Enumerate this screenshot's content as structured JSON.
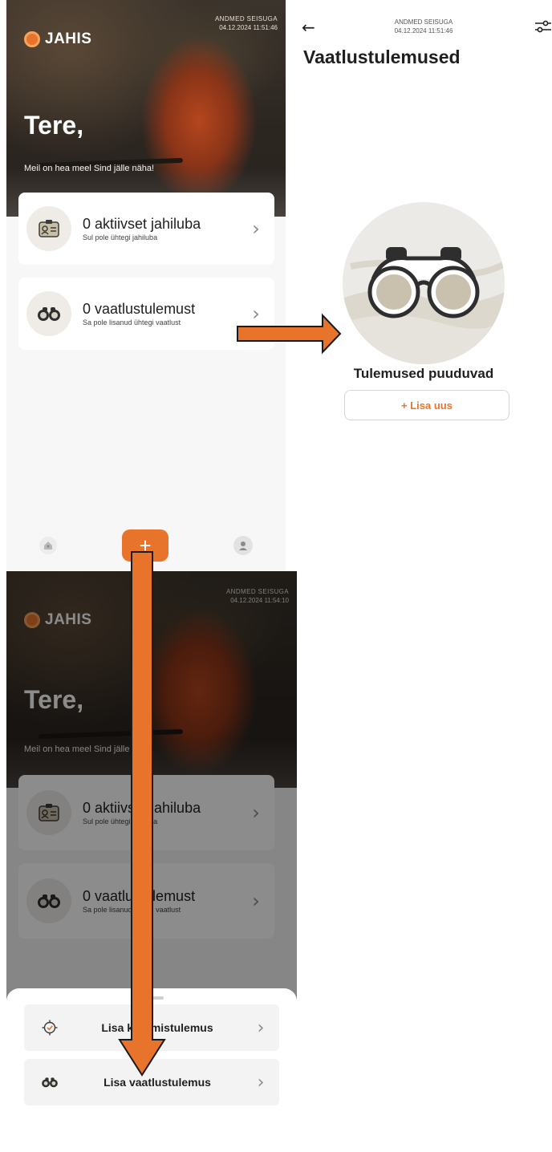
{
  "app": {
    "logo_text": "JAHIS"
  },
  "home": {
    "stamp_label": "ANDMED SEISUGA",
    "stamp_time": "04.12.2024 11:51:46",
    "greeting": "Tere,",
    "greeting_sub": "Meil on hea meel Sind jälle näha!",
    "cards": [
      {
        "title": "0 aktiivset jahiluba",
        "subtitle": "Sul pole ühtegi jahiluba",
        "icon": "id-card-icon"
      },
      {
        "title": "0 vaatlustulemust",
        "subtitle": "Sa pole lisanud ühtegi vaatlust",
        "icon": "binoculars-icon"
      }
    ],
    "nav": {
      "home_icon": "home-icon",
      "add_label": "+",
      "profile_icon": "profile-icon"
    }
  },
  "results": {
    "stamp_label": "ANDMED SEISUGA",
    "stamp_time": "04.12.2024 11:51:46",
    "title": "Vaatlustulemused",
    "empty_title": "Tulemused puuduvad",
    "add_button": "+ Lisa uus"
  },
  "sheet_screen": {
    "stamp_label": "ANDMED SEISUGA",
    "stamp_time": "04.12.2024 11:54:10",
    "greeting": "Tere,",
    "greeting_sub": "Meil on hea meel Sind jälle näha!",
    "cards": [
      {
        "title": "0 aktiivset jahiluba",
        "subtitle": "Sul pole ühtegi jahiluba"
      },
      {
        "title": "0 vaatlustulemust",
        "subtitle": "Sa pole lisanud ühtegi vaatlust"
      }
    ],
    "options": [
      {
        "label": "Lisa küttimistulemus",
        "icon": "crosshair-icon"
      },
      {
        "label": "Lisa vaatlustulemus",
        "icon": "binoculars-icon"
      }
    ],
    "close_label": "×"
  },
  "colors": {
    "accent": "#e8742c",
    "arrow": "#e8742c"
  }
}
